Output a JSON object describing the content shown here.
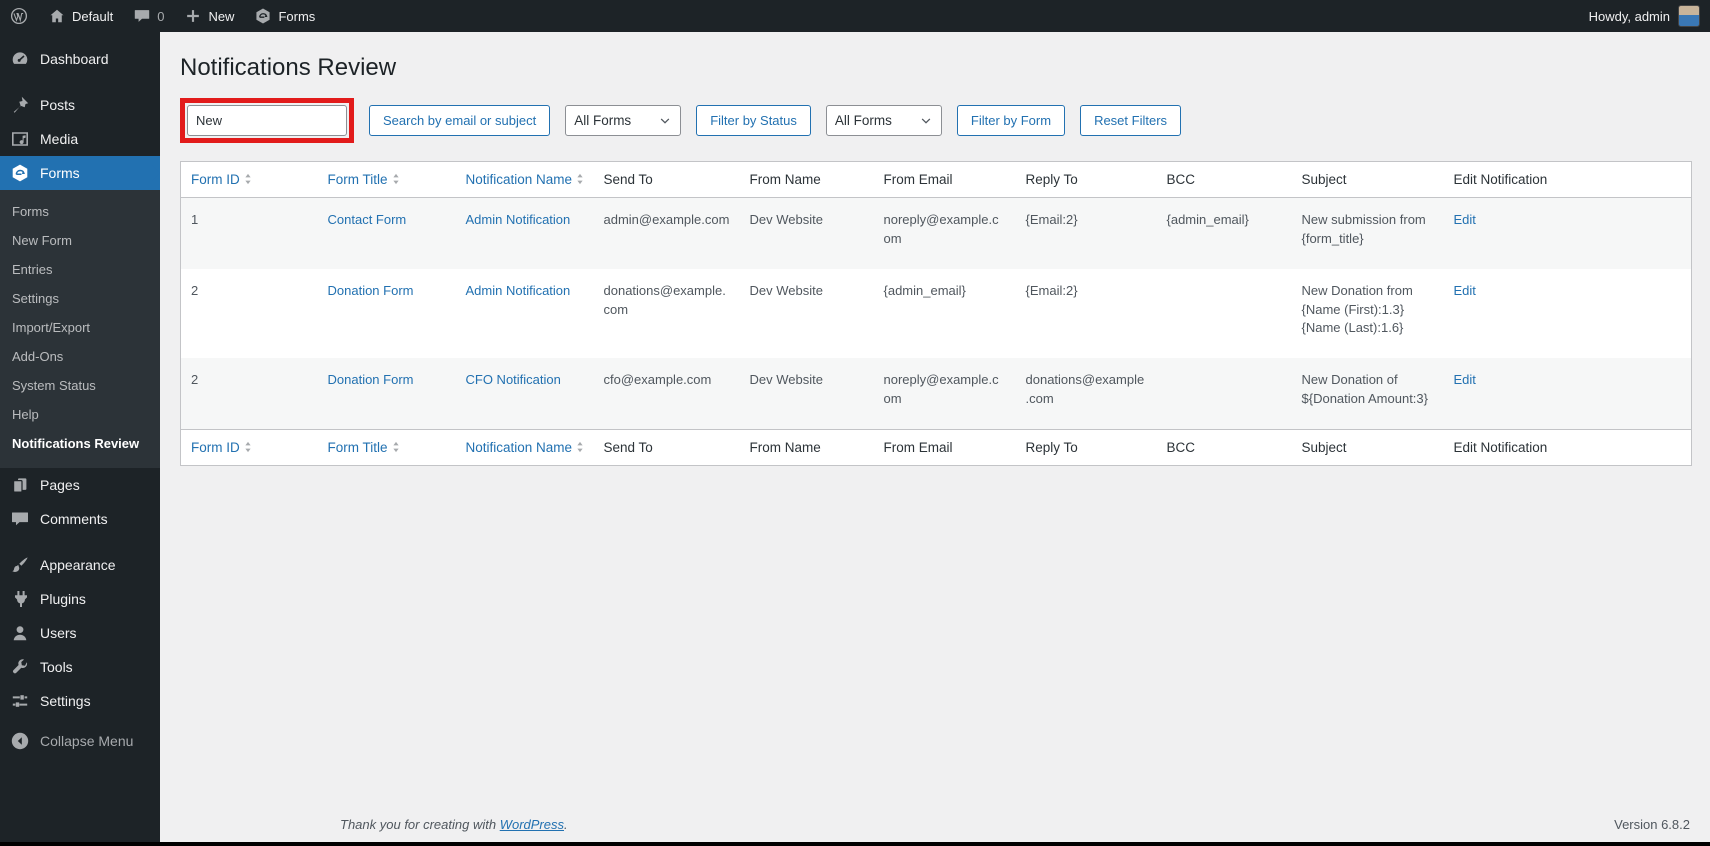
{
  "colors": {
    "accent": "#2271b1",
    "annotation_red": "#e21b1b",
    "admin_dark": "#1d2327",
    "submenu_dark": "#2c3338",
    "content_bg": "#f0f0f1",
    "row_stripe": "#f6f7f7",
    "table_border": "#c3c4c7"
  },
  "admin_bar": {
    "wp_logo_letter": "W",
    "site_name": "Default",
    "comment_count": "0",
    "new_label": "New",
    "forms_label": "Forms",
    "howdy": "Howdy, admin"
  },
  "sidebar": {
    "dashboard": "Dashboard",
    "posts": "Posts",
    "media": "Media",
    "forms": "Forms",
    "forms_submenu": [
      "Forms",
      "New Form",
      "Entries",
      "Settings",
      "Import/Export",
      "Add-Ons",
      "System Status",
      "Help",
      "Notifications Review"
    ],
    "pages": "Pages",
    "comments": "Comments",
    "appearance": "Appearance",
    "plugins": "Plugins",
    "users": "Users",
    "tools": "Tools",
    "settings": "Settings",
    "collapse": "Collapse Menu"
  },
  "page": {
    "title": "Notifications Review",
    "filters": {
      "search_value": "New",
      "search_button": "Search by email or subject",
      "status_filter_value": "All Forms",
      "filter_by_status_button": "Filter by Status",
      "form_filter_value": "All Forms",
      "filter_by_form_button": "Filter by Form",
      "reset_filters_button": "Reset Filters"
    },
    "table": {
      "headers": [
        "Form ID",
        "Form Title",
        "Notification Name",
        "Send To",
        "From Name",
        "From Email",
        "Reply To",
        "BCC",
        "Subject",
        "Edit Notification"
      ],
      "rows": [
        {
          "form_id": "1",
          "form_title": "Contact Form",
          "notification_name": "Admin Notification",
          "send_to": "admin@example.com",
          "from_name": "Dev Website",
          "from_email": "noreply@example.com",
          "reply_to": "{Email:2}",
          "bcc": "{admin_email}",
          "subject": "New submission from {form_title}",
          "edit": "Edit"
        },
        {
          "form_id": "2",
          "form_title": "Donation Form",
          "notification_name": "Admin Notification",
          "send_to": "donations@example.com",
          "from_name": "Dev Website",
          "from_email": "{admin_email}",
          "reply_to": "{Email:2}",
          "bcc": "",
          "subject": "New Donation from {Name (First):1.3} {Name (Last):1.6}",
          "edit": "Edit"
        },
        {
          "form_id": "2",
          "form_title": "Donation Form",
          "notification_name": "CFO Notification",
          "send_to": "cfo@example.com",
          "from_name": "Dev Website",
          "from_email": "noreply@example.com",
          "reply_to": "donations@example.com",
          "bcc": "",
          "subject": "New Donation of ${Donation Amount:3}",
          "edit": "Edit"
        }
      ]
    }
  },
  "footer": {
    "thanks_prefix": "Thank you for creating with",
    "wordpress_link": "WordPress",
    "thanks_suffix": ".",
    "version": "Version 6.8.2"
  }
}
